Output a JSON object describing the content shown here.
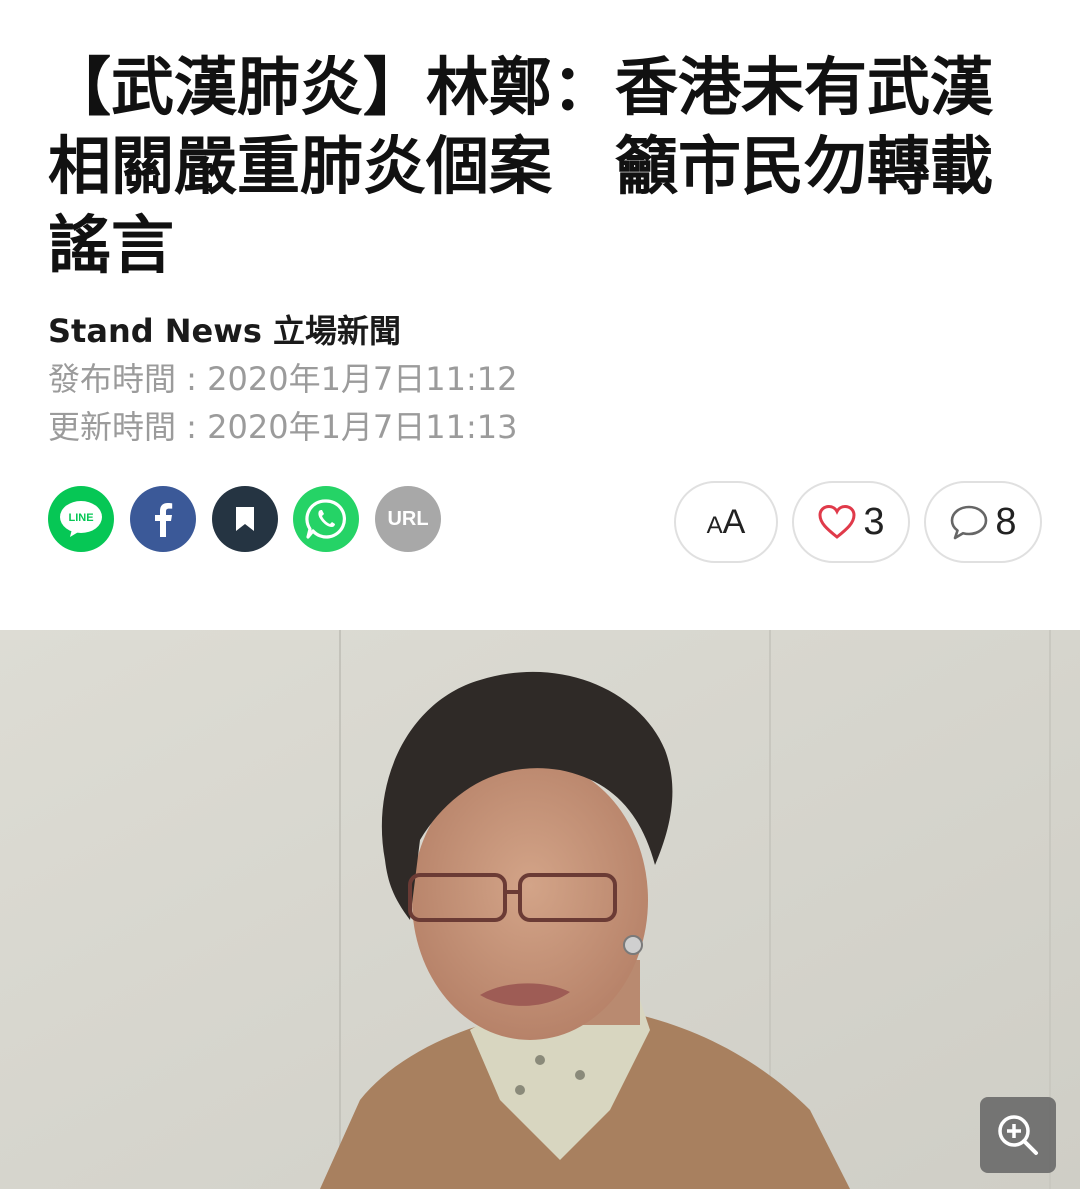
{
  "article": {
    "title": "【武漢肺炎】林鄭：香港未有武漢相關嚴重肺炎個案　籲市民勿轉載謠言",
    "author": "Stand News 立場新聞",
    "published": "發布時間 : 2020年1月7日11:12",
    "updated": "更新時間 : 2020年1月7日11:13"
  },
  "share": {
    "line_label": "LINE",
    "url_label": "URL",
    "colors": {
      "line": "#06c755",
      "facebook": "#3b5998",
      "bookmark": "#253442",
      "whatsapp": "#25d366",
      "url": "#a8a8a8"
    }
  },
  "actions": {
    "font_small": "A",
    "font_big": "A",
    "likes": "3",
    "comments": "8"
  },
  "photo": {
    "zoom_icon": "zoom-in-icon"
  }
}
